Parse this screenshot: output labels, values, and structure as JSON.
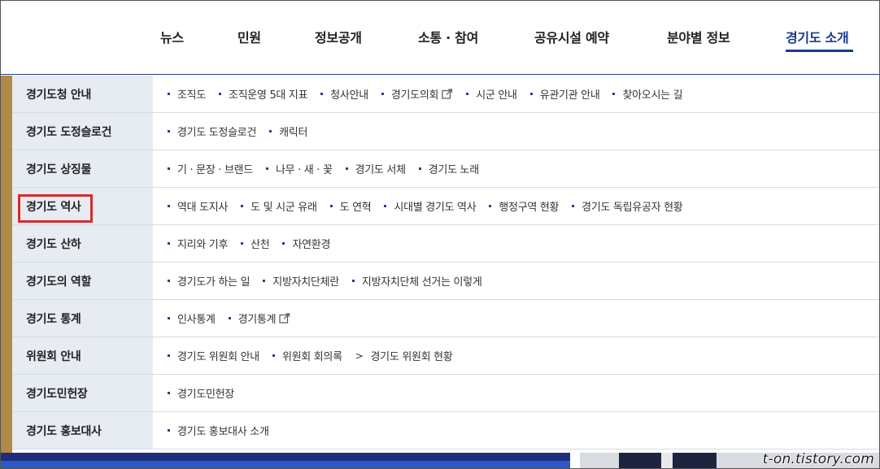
{
  "nav": {
    "items": [
      {
        "label": "뉴스"
      },
      {
        "label": "민원"
      },
      {
        "label": "정보공개"
      },
      {
        "label": "소통 · 참여"
      },
      {
        "label": "공유시설 예약"
      },
      {
        "label": "분야별 정보"
      },
      {
        "label": "경기도 소개"
      }
    ],
    "active_index": 6
  },
  "menu": {
    "rows": [
      {
        "category": "경기도청 안내",
        "links": [
          {
            "label": "조직도"
          },
          {
            "label": "조직운영 5대 지표"
          },
          {
            "label": "청사안내"
          },
          {
            "label": "경기도의회",
            "external": true
          },
          {
            "label": "시군 안내"
          },
          {
            "label": "유관기관 안내"
          },
          {
            "label": "찾아오시는 길"
          }
        ]
      },
      {
        "category": "경기도 도정슬로건",
        "links": [
          {
            "label": "경기도 도정슬로건"
          },
          {
            "label": "캐릭터"
          }
        ]
      },
      {
        "category": "경기도 상징물",
        "links": [
          {
            "label": "기 · 문장 · 브랜드"
          },
          {
            "label": "나무 · 새 · 꽃"
          },
          {
            "label": "경기도 서체"
          },
          {
            "label": "경기도 노래"
          }
        ]
      },
      {
        "category": "경기도 역사",
        "highlighted": true,
        "links": [
          {
            "label": "역대 도지사"
          },
          {
            "label": "도 및 시군 유래"
          },
          {
            "label": "도 연혁"
          },
          {
            "label": "시대별 경기도 역사"
          },
          {
            "label": "행정구역 현황"
          },
          {
            "label": "경기도 독립유공자 현황"
          }
        ]
      },
      {
        "category": "경기도 산하",
        "links": [
          {
            "label": "지리와 기후"
          },
          {
            "label": "산천"
          },
          {
            "label": "자연환경"
          }
        ]
      },
      {
        "category": "경기도의 역할",
        "links": [
          {
            "label": "경기도가 하는 일"
          },
          {
            "label": "지방자치단체란"
          },
          {
            "label": "지방자치단체 선거는 이렇게"
          }
        ]
      },
      {
        "category": "경기도 통계",
        "links": [
          {
            "label": "인사통계"
          },
          {
            "label": "경기통계",
            "external": true
          }
        ]
      },
      {
        "category": "위원회 안내",
        "links": [
          {
            "label": "경기도 위원회 안내"
          },
          {
            "label": "위원회 회의록"
          },
          {
            "label": "경기도 위원회 현황",
            "marker": "gt"
          }
        ]
      },
      {
        "category": "경기도민헌장",
        "links": [
          {
            "label": "경기도민헌장"
          }
        ]
      },
      {
        "category": "경기도 홍보대사",
        "links": [
          {
            "label": "경기도 홍보대사 소개"
          }
        ]
      }
    ]
  },
  "icons": {
    "bullet": "square-bullet-icon",
    "external": "external-link-icon",
    "chevron": "chevron-right-icon"
  },
  "colors": {
    "accent": "#1b3a8c",
    "highlight": "#d92b2b",
    "gold": "#b38a45",
    "category_bg": "#e7ecf3"
  },
  "watermark": "t-on.tistory.com"
}
